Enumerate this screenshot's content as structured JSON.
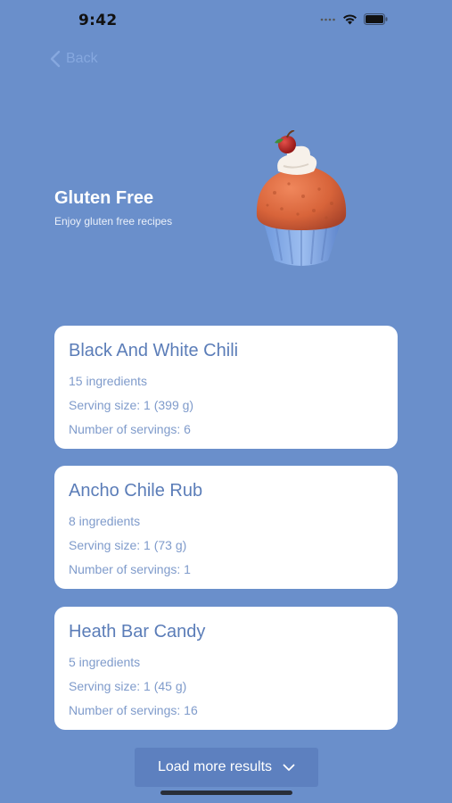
{
  "status_bar": {
    "time": "9:42",
    "icons": [
      "cellular-signal-icon",
      "wifi-icon",
      "battery-icon"
    ]
  },
  "nav": {
    "back_label": "Back"
  },
  "header": {
    "title": "Gluten Free",
    "subtitle": "Enjoy gluten free recipes",
    "image_icon": "cupcake-image"
  },
  "recipes": [
    {
      "title": "Black And White Chili",
      "ingredients": "15 ingredients",
      "serving_size": "Serving size: 1 (399 g)",
      "servings": "Number of servings: 6"
    },
    {
      "title": "Ancho Chile Rub",
      "ingredients": "8 ingredients",
      "serving_size": "Serving size: 1 (73 g)",
      "servings": "Number of servings: 1"
    },
    {
      "title": "Heath Bar Candy",
      "ingredients": "5 ingredients",
      "serving_size": "Serving size: 1 (45 g)",
      "servings": "Number of servings: 16"
    }
  ],
  "load_more": {
    "label": "Load more results",
    "icon": "chevron-down-icon"
  },
  "colors": {
    "background": "#6A8FCB",
    "card": "#FFFFFF",
    "card_title": "#5B7DB8",
    "card_text": "#7F9BCB",
    "button": "#5D80BF"
  }
}
